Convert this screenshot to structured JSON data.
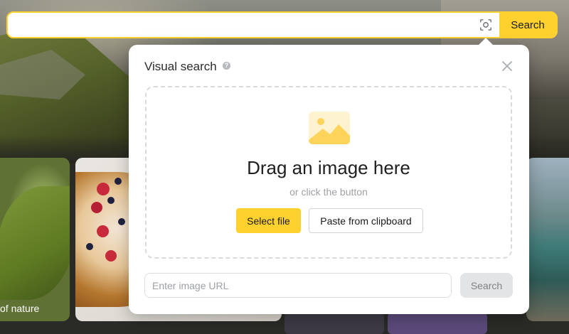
{
  "search_bar": {
    "input_value": "",
    "lens_icon": "camera-lens-icon",
    "search_label": "Search",
    "accent_color": "#fed12f"
  },
  "visual_search": {
    "title": "Visual search",
    "help_icon": "question-icon",
    "help_glyph": "?",
    "close_icon": "close-icon",
    "image_icon": "image-placeholder-icon",
    "drag_heading": "Drag an image here",
    "drag_subtext": "or click the button",
    "select_file_label": "Select file",
    "paste_label": "Paste from clipboard",
    "url_placeholder": "Enter image URL",
    "url_search_label": "Search"
  },
  "background": {
    "tiles": [
      {
        "caption": "of nature"
      }
    ]
  }
}
